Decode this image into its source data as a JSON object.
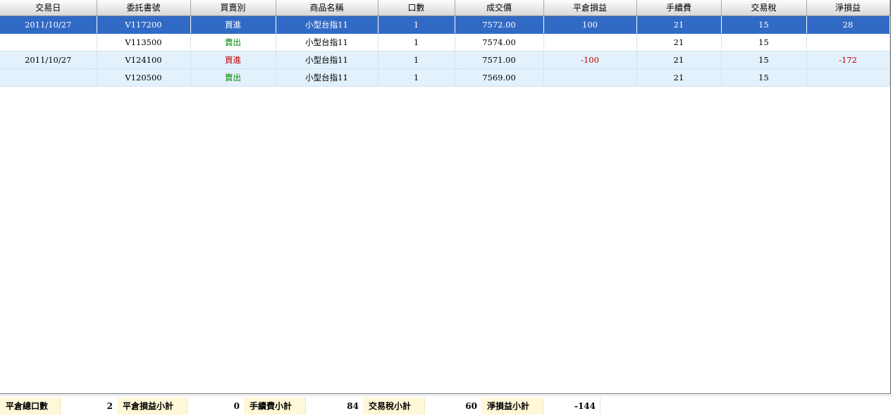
{
  "grid": {
    "columns": [
      "交易日",
      "委託書號",
      "買賣別",
      "商品名稱",
      "口數",
      "成交價",
      "平倉損益",
      "手續費",
      "交易稅",
      "淨損益"
    ],
    "rows": [
      {
        "date": "2011/10/27",
        "order": "V117200",
        "side": "買進",
        "side_type": "buy",
        "product": "小型台指11",
        "qty": "1",
        "price": "7572.00",
        "pnl": "100",
        "fee": "21",
        "tax": "15",
        "net": "28",
        "selected": true
      },
      {
        "date": "",
        "order": "V113500",
        "side": "賣出",
        "side_type": "sell",
        "product": "小型台指11",
        "qty": "1",
        "price": "7574.00",
        "pnl": "",
        "fee": "21",
        "tax": "15",
        "net": "",
        "selected": false
      },
      {
        "date": "2011/10/27",
        "order": "V124100",
        "side": "買進",
        "side_type": "buy",
        "product": "小型台指11",
        "qty": "1",
        "price": "7571.00",
        "pnl": "-100",
        "fee": "21",
        "tax": "15",
        "net": "-172",
        "selected": false
      },
      {
        "date": "",
        "order": "V120500",
        "side": "賣出",
        "side_type": "sell",
        "product": "小型台指11",
        "qty": "1",
        "price": "7569.00",
        "pnl": "",
        "fee": "21",
        "tax": "15",
        "net": "",
        "selected": false
      }
    ]
  },
  "summary": {
    "total_lots_label": "平倉總口數",
    "total_lots": "2",
    "pnl_subtotal_label": "平倉損益小計",
    "pnl_subtotal": "0",
    "fee_subtotal_label": "手續費小計",
    "fee_subtotal": "84",
    "tax_subtotal_label": "交易稅小計",
    "tax_subtotal": "60",
    "net_subtotal_label": "淨損益小計",
    "net_subtotal": "-144"
  },
  "colors": {
    "selected_row": "#316ac5",
    "alt_row": "#e2f1fb",
    "buy_text": "#c00000",
    "sell_text": "#008a00",
    "negative_text": "#c00000",
    "summary_label_bg": "#fff8d8"
  }
}
